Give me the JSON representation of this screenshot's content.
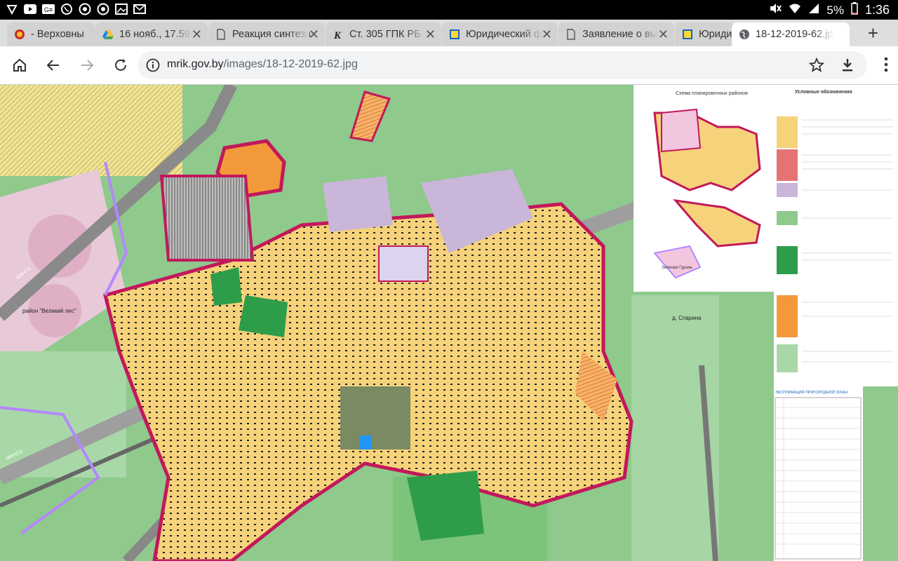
{
  "status_bar": {
    "battery": "5%",
    "time": "1:36"
  },
  "tabs": [
    {
      "title": "- Верховны",
      "favicon": "emblem-icon",
      "active": false
    },
    {
      "title": "16 нояб., 17.59",
      "favicon": "drive-icon",
      "active": false
    },
    {
      "title": "Реакция синтеза",
      "favicon": "page-icon",
      "active": false
    },
    {
      "title": "Ст. 305 ГПК РБ",
      "favicon": "k-icon",
      "active": false
    },
    {
      "title": "Юридический ф",
      "favicon": "flag-icon",
      "active": false
    },
    {
      "title": "Заявление о вы",
      "favicon": "page-icon",
      "active": false
    },
    {
      "title": "Юриди",
      "favicon": "flag-icon",
      "active": false
    },
    {
      "title": "18-12-2019-62.jp",
      "favicon": "globe-icon",
      "active": true
    }
  ],
  "toolbar": {
    "url_domain": "mrik.gov.by",
    "url_path": "/images/18-12-2019-62.jpg"
  },
  "map": {
    "legend_title": "Схема планировочных районов",
    "legend_heading": "Условные обозначения",
    "label_forest": "район \"Великий лес\"",
    "label_village": "д. Спарина",
    "label_minsk1": "МИНСК",
    "label_minsk2": "МИНСК",
    "explication_title": "ЭКСПЛИКАЦИЯ ПРИГОРОДНОЙ ЗОНЫ",
    "district_label": "Зеленая Гурань",
    "colors": {
      "residential": "#f6d27a",
      "boundary": "#c2185b",
      "forest": "#8fc98c",
      "industrial": "#c9b6d9",
      "road": "#8a8a8a",
      "green": "#2e9d4a"
    }
  }
}
